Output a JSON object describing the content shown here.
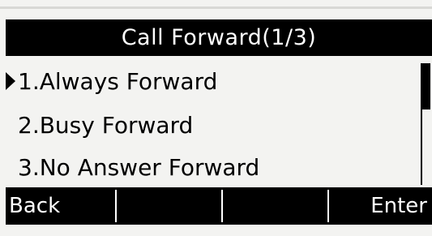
{
  "title": "Call Forward(1/3)",
  "menu": {
    "items": [
      {
        "label": "1.Always Forward",
        "selected": true
      },
      {
        "label": "2.Busy Forward",
        "selected": false
      },
      {
        "label": "3.No Answer Forward",
        "selected": false
      }
    ],
    "selected_icon": "selection-pointer-icon"
  },
  "scroll": {
    "position_fraction": 0.0,
    "visible_fraction": 0.38
  },
  "softkeys": {
    "key1": "Back",
    "key2": "",
    "key3": "",
    "key4": "Enter"
  }
}
